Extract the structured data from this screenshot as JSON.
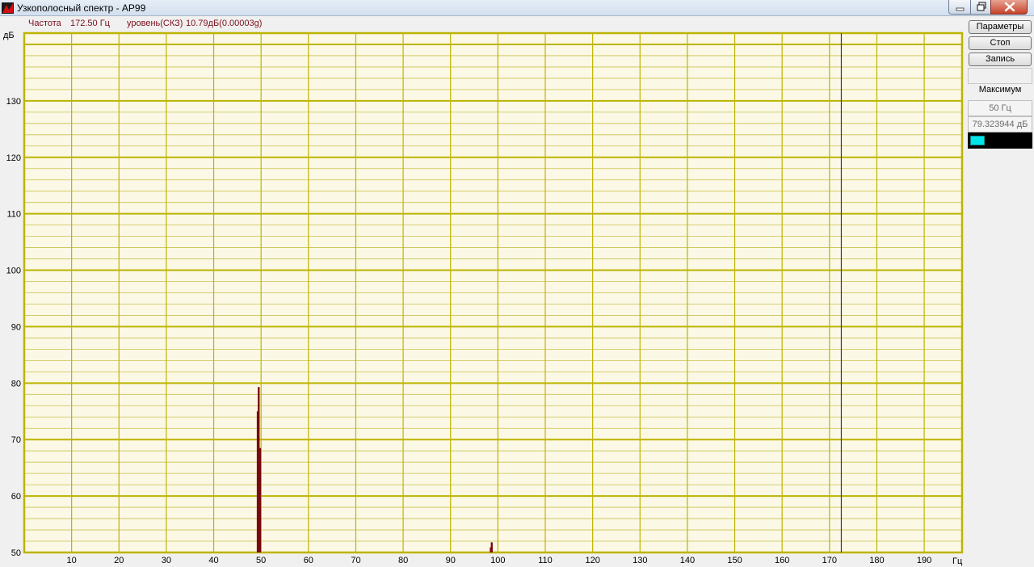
{
  "window": {
    "title": "Узкополосный спектр - AP99"
  },
  "readout": {
    "freq_label": "Частота",
    "freq_value": "172.50 Гц",
    "level_label": "уровень(СКЗ)",
    "level_value": "10.79дБ(0.00003g)"
  },
  "side": {
    "params_label": "Параметры",
    "stop_label": "Стоп",
    "record_label": "Запись",
    "max_label": "Максимум",
    "max_freq": "50 Гц",
    "max_level": "79.323944  дБ",
    "swatch_color": "#00e5ea"
  },
  "chart_data": {
    "type": "bar",
    "xlabel": "Гц",
    "ylabel": "дБ",
    "xlim": [
      0,
      198
    ],
    "ylim": [
      50,
      142
    ],
    "x_ticks": [
      10,
      20,
      30,
      40,
      50,
      60,
      70,
      80,
      90,
      100,
      110,
      120,
      130,
      140,
      150,
      160,
      170,
      180,
      190
    ],
    "y_ticks": [
      60,
      70,
      80,
      90,
      100,
      110,
      120,
      130
    ],
    "y_base_label": 50,
    "grid": true,
    "cursor_x": 172.5,
    "cursor_color": "#1f3a8a",
    "bar_color": "#7a0a0a",
    "points": [
      {
        "x": 49.5,
        "y": 79.3
      },
      {
        "x": 49.3,
        "y": 75.0
      },
      {
        "x": 49.8,
        "y": 68.5
      },
      {
        "x": 98.7,
        "y": 51.8
      },
      {
        "x": 98.5,
        "y": 50.9
      }
    ]
  }
}
